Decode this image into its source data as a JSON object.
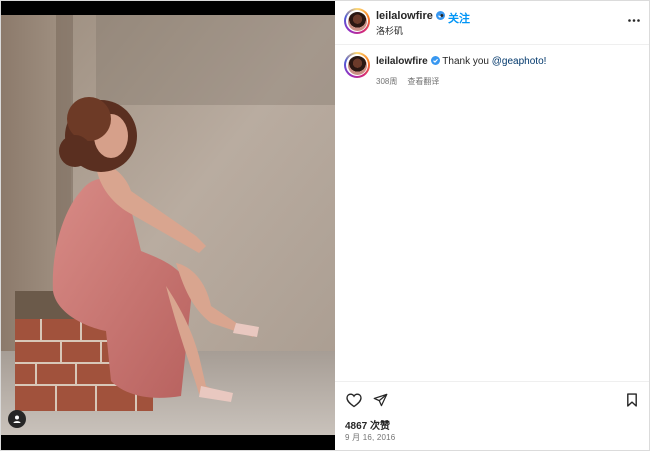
{
  "post": {
    "username": "leilalowfire",
    "dot": "•",
    "follow_label": "关注",
    "location": "洛杉矶",
    "caption_text": "Thank you ",
    "caption_mention": "@geaphoto!",
    "time_ago": "308周",
    "translate_label": "查看翻译",
    "likes": "4867 次赞",
    "date": "9 月 16, 2016"
  },
  "colors": {
    "accent": "#0095f6",
    "verified": "#3897f0",
    "text": "#262626",
    "muted": "#737373"
  },
  "icons": {
    "more": "more-options-icon",
    "like": "heart-icon",
    "share": "paper-plane-icon",
    "save": "bookmark-icon",
    "tag": "user-tag-icon",
    "verified": "verified-badge-icon"
  }
}
